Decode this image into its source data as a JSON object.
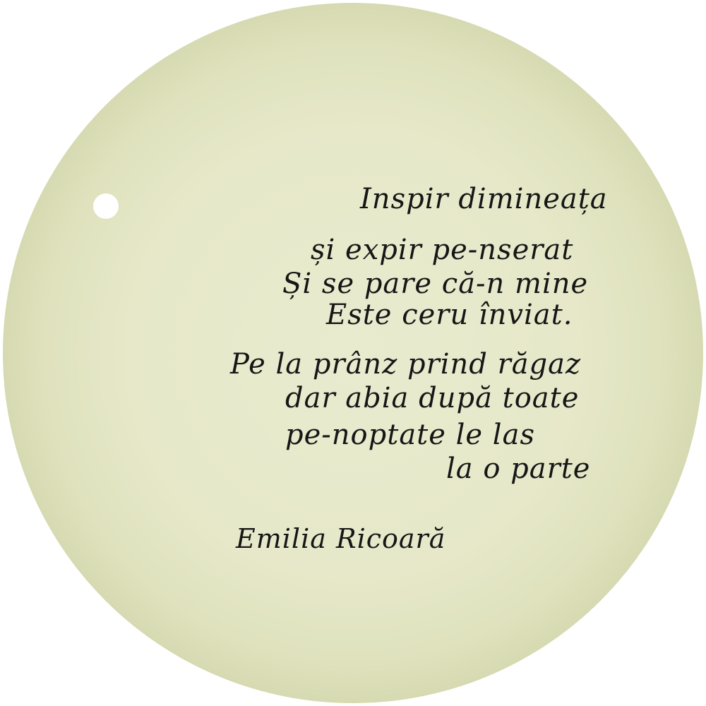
{
  "poem": {
    "stanza1": [
      "Inspir dimineața",
      "și expir pe-nserat",
      "Și se pare că-n mine",
      "Este ceru înviat."
    ],
    "stanza2": [
      "Pe la prânz prind răgaz",
      "dar abia după toate",
      "pe-noptate le las",
      "la o parte"
    ]
  },
  "signature": "Emilia Ricoară"
}
